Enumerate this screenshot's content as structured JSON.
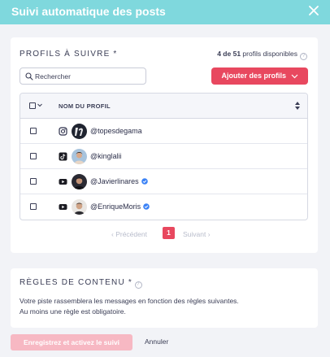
{
  "header": {
    "title": "Suivi automatique des posts"
  },
  "profiles_section": {
    "title": "PROFILS À SUIVRE *",
    "available_count": "4 de 51",
    "available_suffix": "profils disponibles",
    "search_placeholder": "Rechercher",
    "add_button_label": "Ajouter des profils",
    "column_header": "NOM DU PROFIL",
    "rows": [
      {
        "network": "instagram-icon",
        "handle": "@topesdegama",
        "verified": false
      },
      {
        "network": "tiktok-icon",
        "handle": "@kinglalii",
        "verified": false
      },
      {
        "network": "youtube-icon",
        "handle": "@Javierlinares",
        "verified": true
      },
      {
        "network": "youtube-icon",
        "handle": "@EnriqueMoris",
        "verified": true
      }
    ]
  },
  "pagination": {
    "prev_label": "Précédent",
    "current_page": "1",
    "next_label": "Suivant"
  },
  "rules_section": {
    "title": "RÈGLES DE CONTENU *",
    "description_line1": "Votre piste rassemblera les messages en fonction des règles suivantes.",
    "description_line2": "Au moins une règle est obligatoire."
  },
  "footer": {
    "save_label": "Enregistrez et activez le suivi",
    "cancel_label": "Annuler"
  },
  "colors": {
    "header_bg": "#7fd8dd",
    "accent": "#e8485f",
    "accent_disabled": "#f7b8c3",
    "verified": "#3b82f6"
  }
}
